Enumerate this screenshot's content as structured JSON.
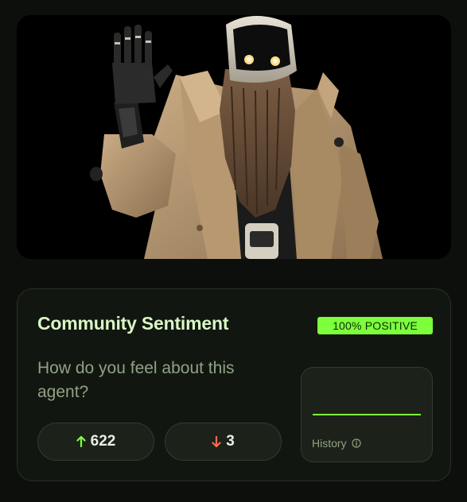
{
  "hero": {
    "image": "robot-in-trench-coat-waving",
    "background": "#000000"
  },
  "sentiment": {
    "title": "Community Sentiment",
    "badge": "100% POSITIVE",
    "question": "How do you feel about this agent?",
    "upvotes": "622",
    "downvotes": "3",
    "history_label": "History",
    "icons": {
      "up": "arrow-up-icon",
      "down": "arrow-down-icon",
      "info": "info-icon"
    },
    "colors": {
      "accent": "#7dff3c",
      "up_arrow": "#7dff3c",
      "down_arrow": "#ff6a4d",
      "title": "#d9f7c3",
      "muted": "#8fa383"
    }
  }
}
